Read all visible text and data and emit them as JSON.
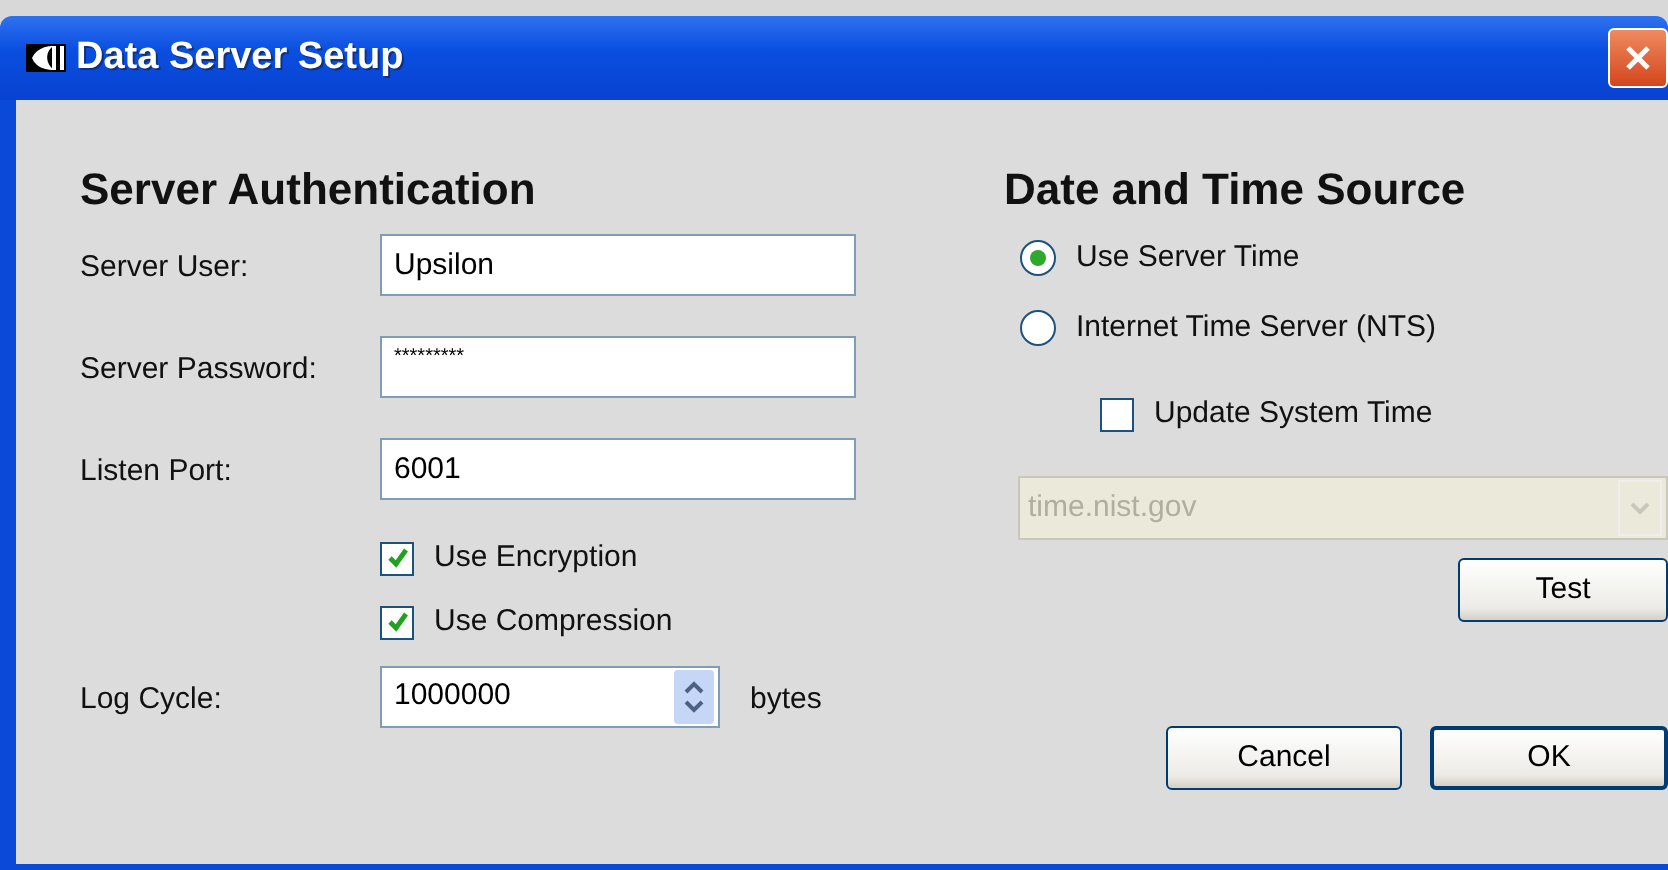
{
  "window": {
    "title": "Data Server Setup"
  },
  "server_authentication": {
    "heading": "Server Authentication",
    "fields": [
      {
        "label": "Server User:",
        "value": "Upsilon",
        "kind": "text"
      },
      {
        "label": "Server Password:",
        "value": "*********",
        "kind": "masked"
      },
      {
        "label": "Listen Port:",
        "value": "6001",
        "kind": "text"
      }
    ],
    "options": [
      {
        "label": "Use Encryption",
        "checked": true
      },
      {
        "label": "Use Compression",
        "checked": true
      }
    ],
    "log_cycle": {
      "label": "Log Cycle:",
      "value": "1000000",
      "unit": "bytes"
    }
  },
  "date_time_source": {
    "heading": "Date and Time Source",
    "sources": [
      {
        "label": "Use Server Time",
        "selected": true
      },
      {
        "label": "Internet Time Server (NTS)",
        "selected": false
      }
    ],
    "update_system_time": {
      "label": "Update System Time",
      "checked": false
    },
    "time_server": {
      "value": "time.nist.gov",
      "disabled": true
    },
    "test_button": "Test"
  },
  "buttons": [
    "Cancel",
    "OK"
  ]
}
